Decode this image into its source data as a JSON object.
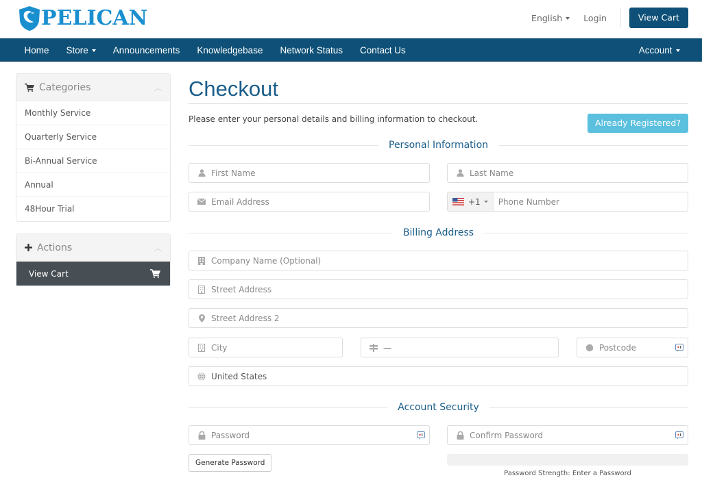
{
  "header": {
    "brand": "PELICAN",
    "language": "English",
    "login": "Login",
    "view_cart": "View Cart"
  },
  "nav": {
    "items": [
      {
        "label": "Home",
        "dropdown": false
      },
      {
        "label": "Store",
        "dropdown": true
      },
      {
        "label": "Announcements",
        "dropdown": false
      },
      {
        "label": "Knowledgebase",
        "dropdown": false
      },
      {
        "label": "Network Status",
        "dropdown": false
      },
      {
        "label": "Contact Us",
        "dropdown": false
      }
    ],
    "account": "Account"
  },
  "sidebar": {
    "categories": {
      "title": "Categories",
      "icon": "shopping-cart-icon",
      "items": [
        "Monthly Service",
        "Quarterly Service",
        "Bi-Annual Service",
        "Annual",
        "48Hour Trial"
      ]
    },
    "actions": {
      "title": "Actions",
      "icon": "plus-icon",
      "items": [
        {
          "label": "View Cart",
          "icon": "shopping-cart-icon",
          "active": true
        }
      ]
    }
  },
  "main": {
    "title": "Checkout",
    "intro": "Please enter your personal details and billing information to checkout.",
    "already_registered": "Already Registered?",
    "sections": {
      "personal": "Personal Information",
      "billing": "Billing Address",
      "security": "Account Security"
    },
    "fields": {
      "first_name": {
        "placeholder": "First Name",
        "icon": "user-icon"
      },
      "last_name": {
        "placeholder": "Last Name",
        "icon": "user-icon"
      },
      "email": {
        "placeholder": "Email Address",
        "icon": "envelope-icon"
      },
      "phone": {
        "placeholder": "Phone Number",
        "country_code": "+1",
        "flag": "us-flag-icon"
      },
      "company": {
        "placeholder": "Company Name (Optional)",
        "icon": "building-icon"
      },
      "street": {
        "placeholder": "Street Address",
        "icon": "building-outline-icon"
      },
      "street2": {
        "placeholder": "Street Address 2",
        "icon": "map-marker-icon"
      },
      "city": {
        "placeholder": "City",
        "icon": "building-outline-icon"
      },
      "state": {
        "value": "—",
        "icon": "signpost-icon"
      },
      "postcode": {
        "placeholder": "Postcode",
        "icon": "certificate-icon"
      },
      "country": {
        "value": "United States",
        "icon": "globe-icon"
      },
      "password": {
        "placeholder": "Password",
        "icon": "lock-icon"
      },
      "confirm_password": {
        "placeholder": "Confirm Password",
        "icon": "lock-icon"
      }
    },
    "generate_password": "Generate Password",
    "password_strength": {
      "value": 0,
      "label": "Password Strength: Enter a Password"
    }
  },
  "colors": {
    "brand_blue": "#0e5077",
    "title_blue": "#1a5d8a",
    "info_button": "#5bc0de",
    "active_sidebar": "#474e54"
  }
}
